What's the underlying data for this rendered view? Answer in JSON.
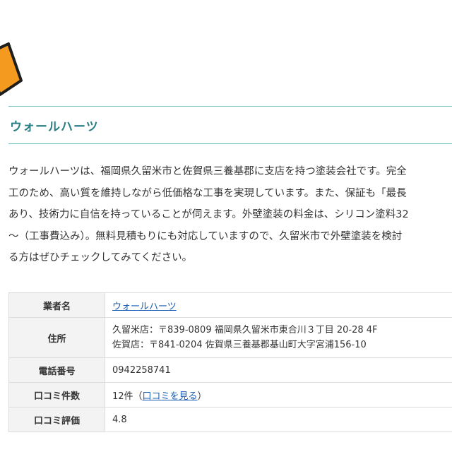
{
  "colors": {
    "heading_accent": "#2a7f86",
    "border_accent": "#6cc4c4",
    "link": "#1a5fb4",
    "deco_orange": "#f39a1f"
  },
  "section": {
    "title": "ウォールハーツ"
  },
  "intro_lines": [
    "ウォールハーツは、福岡県久留米市と佐賀県三養基郡に支店を持つ塗装会社です。完全",
    "工のため、高い質を維持しながら低価格な工事を実現しています。また、保証も「最長",
    "あり、技術力に自信を持っていることが伺えます。外壁塗装の料金は、シリコン塗料32",
    "〜（工事費込み）。無料見積もりにも対応していますので、久留米市で外壁塗装を検討",
    "る方はぜひチェックしてみてください。"
  ],
  "table": {
    "company_label": "業者名",
    "company_value": "ウォールハーツ",
    "address_label": "住所",
    "address_lines": [
      "久留米店：〒839-0809 福岡県久留米市東合川３丁目 20-28 4F",
      "佐賀店：〒841-0204 佐賀県三養基郡基山町大字宮浦156-10"
    ],
    "phone_label": "電話番号",
    "phone_value": "0942258741",
    "reviews_count_label": "口コミ件数",
    "reviews_count_prefix": "12件（",
    "reviews_link": "口コミを見る",
    "reviews_count_suffix": "）",
    "rating_label": "口コミ評価",
    "rating_value": "4.8"
  }
}
